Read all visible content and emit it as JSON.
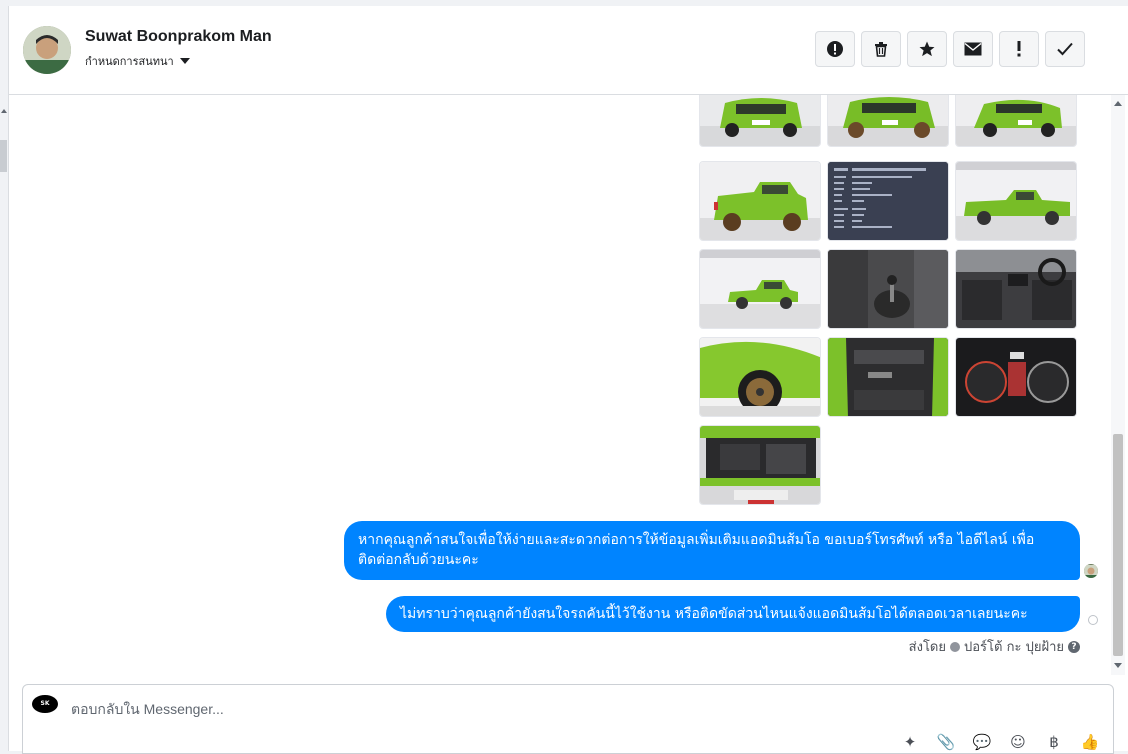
{
  "contact": {
    "name": "Suwat Boonprakom Man",
    "subtitle": "กำหนดการสนทนา"
  },
  "header_actions": [
    {
      "icon": "alert-circle-icon"
    },
    {
      "icon": "trash-icon"
    },
    {
      "icon": "star-icon"
    },
    {
      "icon": "envelope-icon"
    },
    {
      "icon": "exclamation-icon"
    },
    {
      "icon": "checkmark-icon"
    }
  ],
  "photos": [
    "car-front-view",
    "car-front-angle",
    "car-front-three-quarter",
    "car-rear-view",
    "spec-sheet",
    "car-side-view",
    "car-side-profile",
    "manual-gear-shifter",
    "dashboard-interior",
    "wheel-closeup",
    "door-interior",
    "gauge-cluster",
    "engine-bay"
  ],
  "messages": [
    {
      "text": "หากคุณลูกค้าสนใจเพื่อให้ง่ายและสะดวกต่อการให้ข้อมูลเพิ่มเติมแอดมินส้มโอ ขอเบอร์โทรศัพท์ หรือ ไอดีไลน์ เพื่อติดต่อกลับด้วยนะคะ"
    },
    {
      "text": "ไม่ทราบว่าคุณลูกค้ายังสนใจรถคันนี้ไว้ใช้งาน หรือติดขัดส่วนไหนแจ้งแอดมินส้มโอได้ตลอดเวลาเลยนะคะ"
    }
  ],
  "sent_by": {
    "label": "ส่งโดย",
    "sender": "ปอร์โต้ กะ ปุยฝ้าย",
    "help_glyph": "?"
  },
  "reply": {
    "placeholder": "ตอบกลับใน Messenger...",
    "page_logo_text": "SK"
  },
  "reply_tools": [
    {
      "icon": "saved-reply-icon",
      "glyph": "✦"
    },
    {
      "icon": "paperclip-icon",
      "glyph": "📎"
    },
    {
      "icon": "chat-bubble-icon",
      "glyph": "💬"
    },
    {
      "icon": "emoji-icon",
      "glyph": "☺"
    },
    {
      "icon": "baht-icon",
      "glyph": "฿"
    },
    {
      "icon": "thumbs-up-icon",
      "glyph": "👍"
    }
  ],
  "colors": {
    "bubble": "#0084ff",
    "car_green": "#7cc12a"
  }
}
